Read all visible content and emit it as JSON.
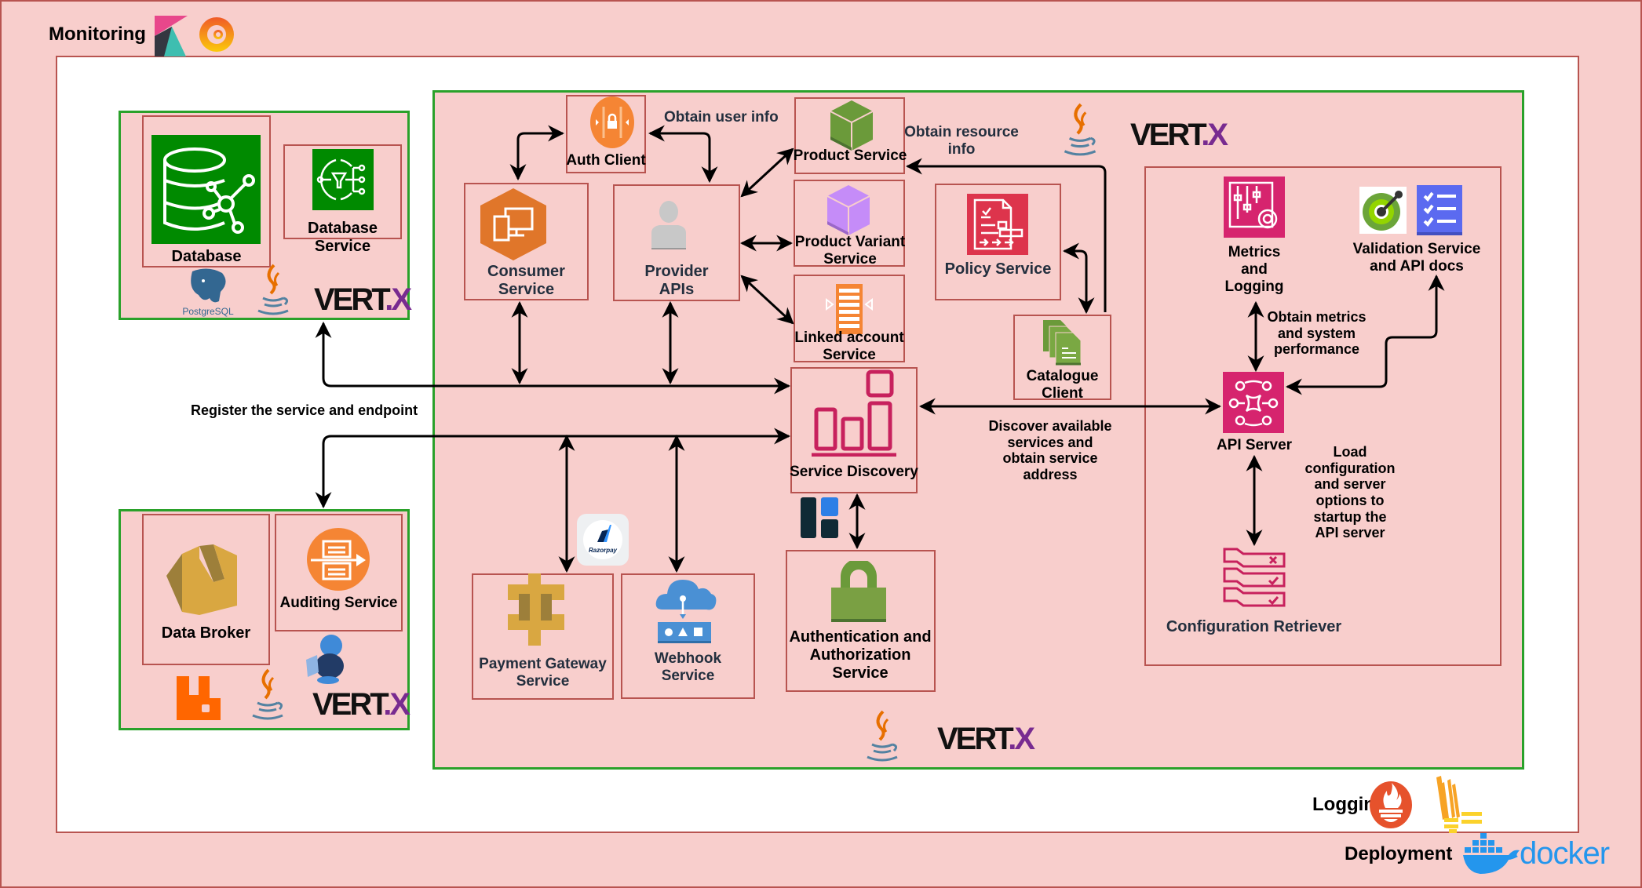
{
  "sections": {
    "monitoring": "Monitoring",
    "logging": "Logging",
    "deployment": "Deployment"
  },
  "tech_logos": {
    "vertx": {
      "text_main": "VERT",
      "text_dot": ".",
      "text_x": "X"
    },
    "postgres": "PostgreSQL",
    "razorpay": "Razorpay",
    "docker": "docker"
  },
  "components": {
    "database": "Database",
    "database_service": [
      "Database",
      "Service"
    ],
    "data_broker": "Data Broker",
    "auditing_service": "Auditing Service",
    "auth_client": "Auth Client",
    "consumer_service": [
      "Consumer",
      "Service"
    ],
    "provider_apis": [
      "Provider",
      "APIs"
    ],
    "product_service": "Product Service",
    "product_variant_service": [
      "Product Variant",
      "Service"
    ],
    "linked_account_service": [
      "Linked account",
      "Service"
    ],
    "policy_service": "Policy Service",
    "catalogue_client": [
      "Catalogue",
      "Client"
    ],
    "service_discovery": "Service Discovery",
    "payment_gateway_service": [
      "Payment Gateway",
      "Service"
    ],
    "webhook_service": [
      "Webhook",
      "Service"
    ],
    "authn_authz_service": [
      "Authentication and",
      "Authorization",
      "Service"
    ],
    "metrics_logging": [
      "Metrics",
      "and",
      "Logging"
    ],
    "validation_service": [
      "Validation Service",
      "and API docs"
    ],
    "api_server": "API Server",
    "configuration_retriever": "Configuration Retriever"
  },
  "edge_labels": {
    "obtain_user_info": "Obtain user info",
    "obtain_resource_info": [
      "Obtain resource",
      "info"
    ],
    "register_service": "Register the service and endpoint",
    "discover_services": [
      "Discover available",
      "services and",
      "obtain service",
      "address"
    ],
    "obtain_metrics": [
      "Obtain metrics",
      "and system",
      "performance"
    ],
    "load_config": [
      "Load",
      "configuration",
      "and server",
      "options to",
      "startup the",
      "API server"
    ]
  },
  "colors": {
    "pink_fill": "#f8cecc",
    "red_border": "#b85450",
    "green_border": "#2aa12a",
    "aws_green": "#008a00",
    "aws_orange": "#f58534",
    "aws_pink": "#d6246e",
    "vertx_purple": "#782b90"
  }
}
